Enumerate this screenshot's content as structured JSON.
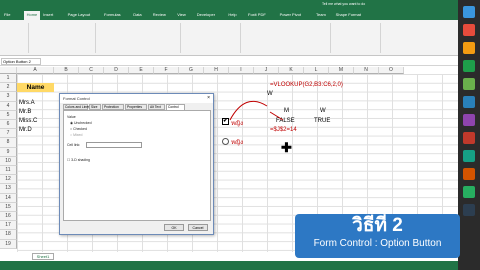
{
  "ribbon_tabs": [
    "File",
    "Home",
    "Insert",
    "Page Layout",
    "Formulas",
    "Data",
    "Review",
    "View",
    "Developer",
    "Help",
    "Foxit PDF",
    "Power Pivot",
    "Team",
    "Shape Format"
  ],
  "tell_me": "Tell me what you want to do",
  "name_box": "Option Button 2",
  "columns": [
    "A",
    "B",
    "C",
    "D",
    "E",
    "F",
    "G",
    "H",
    "I",
    "J",
    "K",
    "L",
    "M",
    "N",
    "O"
  ],
  "rows": [
    "1",
    "2",
    "3",
    "4",
    "5",
    "6",
    "7",
    "8",
    "9",
    "10",
    "11",
    "12",
    "13",
    "14",
    "15",
    "16",
    "17",
    "18",
    "19"
  ],
  "sheet": {
    "name_header": "Name",
    "names": [
      "Mrs.A",
      "Mr.B",
      "Miss.C",
      "Mr.D"
    ],
    "formula_vlookup": "=VLOOKUP(G2,B3:C6,2,0)",
    "w_label": "W",
    "m_label": "M",
    "w_label2": "W",
    "false_label": "FALSE",
    "true_label": "TRUE",
    "formula_if": "=$J$2=14",
    "checkbox_label": "หญิง",
    "radio_label": "หญิง"
  },
  "dialog": {
    "title": "Format Control",
    "close": "×",
    "tabs": [
      "Colors and Lines",
      "Size",
      "Protection",
      "Properties",
      "Alt Text",
      "Control"
    ],
    "value_label": "Value",
    "option_unchecked": "Unchecked",
    "option_checked": "Checked",
    "option_mixed": "Mixed",
    "cell_link_label": "Cell link:",
    "shading_label": "3-D shading",
    "ok_label": "OK",
    "cancel_label": "Cancel"
  },
  "sheet_tab": "Sheet1",
  "banner": {
    "title": "วิธีที่ 2",
    "subtitle": "Form Control : Option Button"
  }
}
